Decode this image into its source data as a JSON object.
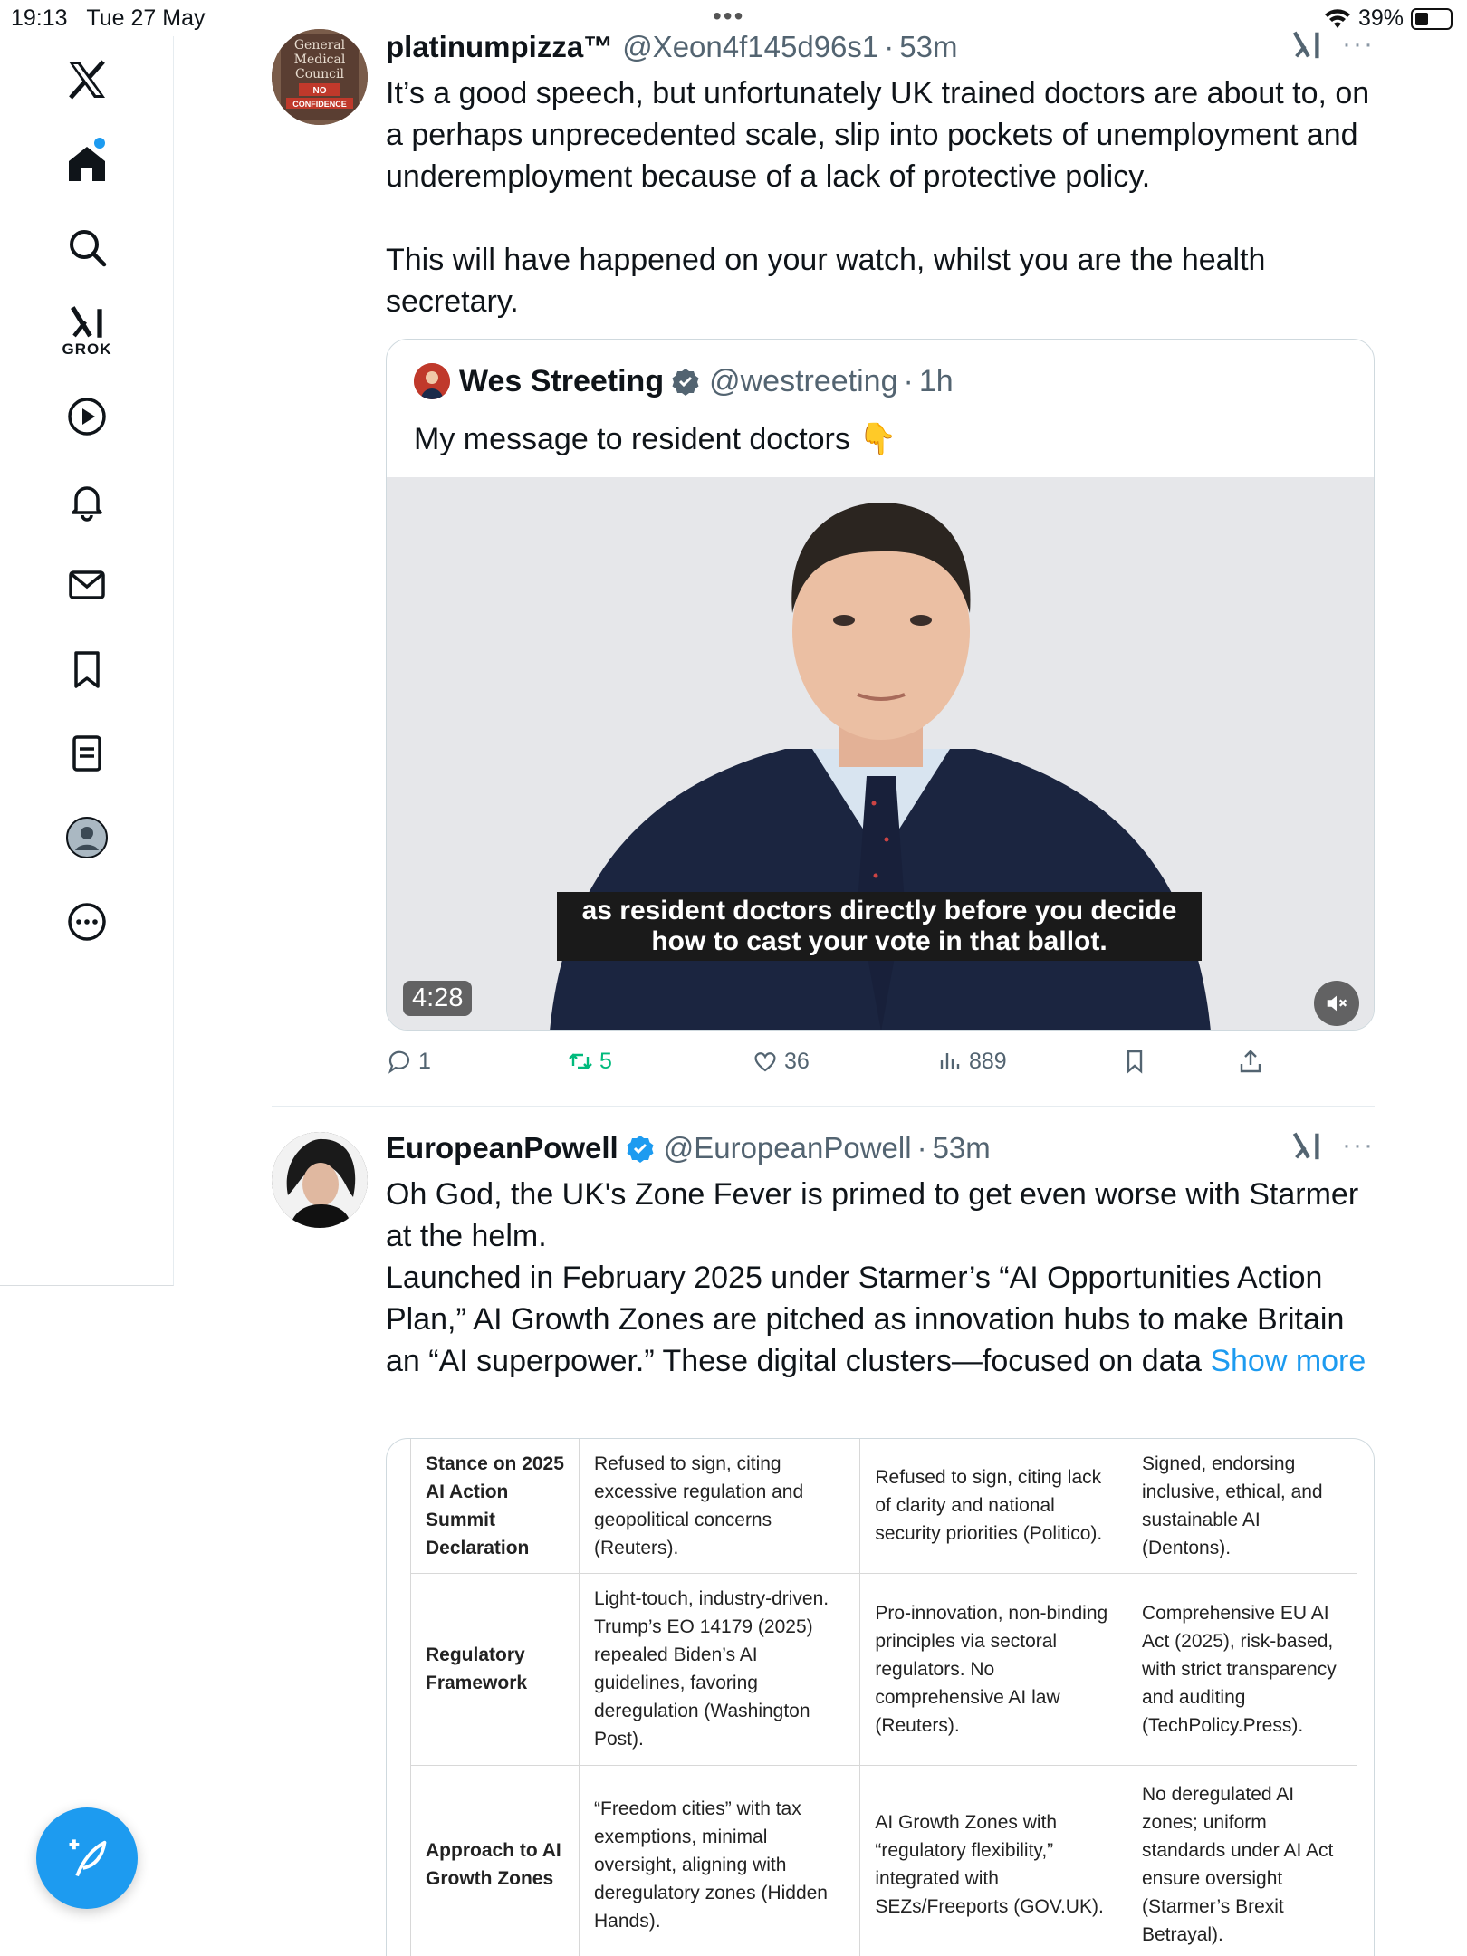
{
  "status_bar": {
    "time": "19:13",
    "date": "Tue 27 May",
    "battery": "39%",
    "battery_level": 0.39
  },
  "sidebar": {
    "grok_label": "GROK",
    "items": [
      "x-logo",
      "home-icon",
      "search-icon",
      "grok-icon",
      "video-icon",
      "bell-icon",
      "mail-icon",
      "bookmark-icon",
      "lists-icon",
      "profile-icon",
      "more-icon"
    ],
    "accent_color": "#1d9bf0"
  },
  "posts": [
    {
      "name": "platinumpizza™",
      "handle": "@Xeon4f145d96s1",
      "time": "53m",
      "avatar_text": [
        "General",
        "Medical",
        "Council",
        "NO",
        "CONFIDENCE"
      ],
      "text": "It’s a good speech, but unfortunately UK trained doctors are about to, on a perhaps unprecedented scale, slip into pockets of unemployment and underemployment because of a lack of protective policy.\n\nThis will have happened on your watch, whilst you are the health secretary.",
      "quote": {
        "name": "Wes Streeting",
        "handle": "@westreeting",
        "time": "1h",
        "text": "My message to resident doctors 👇",
        "video_caption": "as resident doctors directly before you decide how to cast your vote in that ballot.",
        "duration": "4:28"
      },
      "stats": {
        "replies": "1",
        "reposts": "5",
        "likes": "36",
        "views": "889"
      }
    },
    {
      "name": "EuropeanPowell",
      "handle": "@EuropeanPowell",
      "time": "53m",
      "text": "Oh God, the UK's Zone Fever is primed to get even worse with Starmer at the helm.\nLaunched in February 2025 under Starmer’s “AI Opportunities Action Plan,” AI Growth Zones are pitched as innovation hubs to make Britain an “AI superpower.” These digital clusters—focused on data ",
      "show_more": "Show more",
      "table": [
        {
          "label": "Stance on 2025 AI Action Summit Declaration",
          "us": "Refused to sign, citing excessive regulation and geopolitical concerns (Reuters).",
          "uk": "Refused to sign, citing lack of clarity and national security priorities (Politico).",
          "eu": "Signed, endorsing inclusive, ethical, and sustainable AI (Dentons)."
        },
        {
          "label": "Regulatory Framework",
          "us": "Light-touch, industry-driven. Trump’s EO 14179 (2025) repealed Biden’s AI guidelines, favoring deregulation (Washington Post).",
          "uk": "Pro-innovation, non-binding principles via sectoral regulators. No comprehensive AI law (Reuters).",
          "eu": "Comprehensive EU AI Act (2025), risk-based, with strict transparency and auditing (TechPolicy.Press)."
        },
        {
          "label": "Approach to AI Growth Zones",
          "us": "“Freedom cities” with tax exemptions, minimal oversight, aligning with deregulatory zones (Hidden Hands).",
          "uk": "AI Growth Zones with “regulatory flexibility,” integrated with SEZs/Freeports (GOV.UK).",
          "eu": "No deregulated AI zones; uniform standards under AI Act ensure oversight (Starmer’s Brexit Betrayal)."
        }
      ]
    }
  ]
}
